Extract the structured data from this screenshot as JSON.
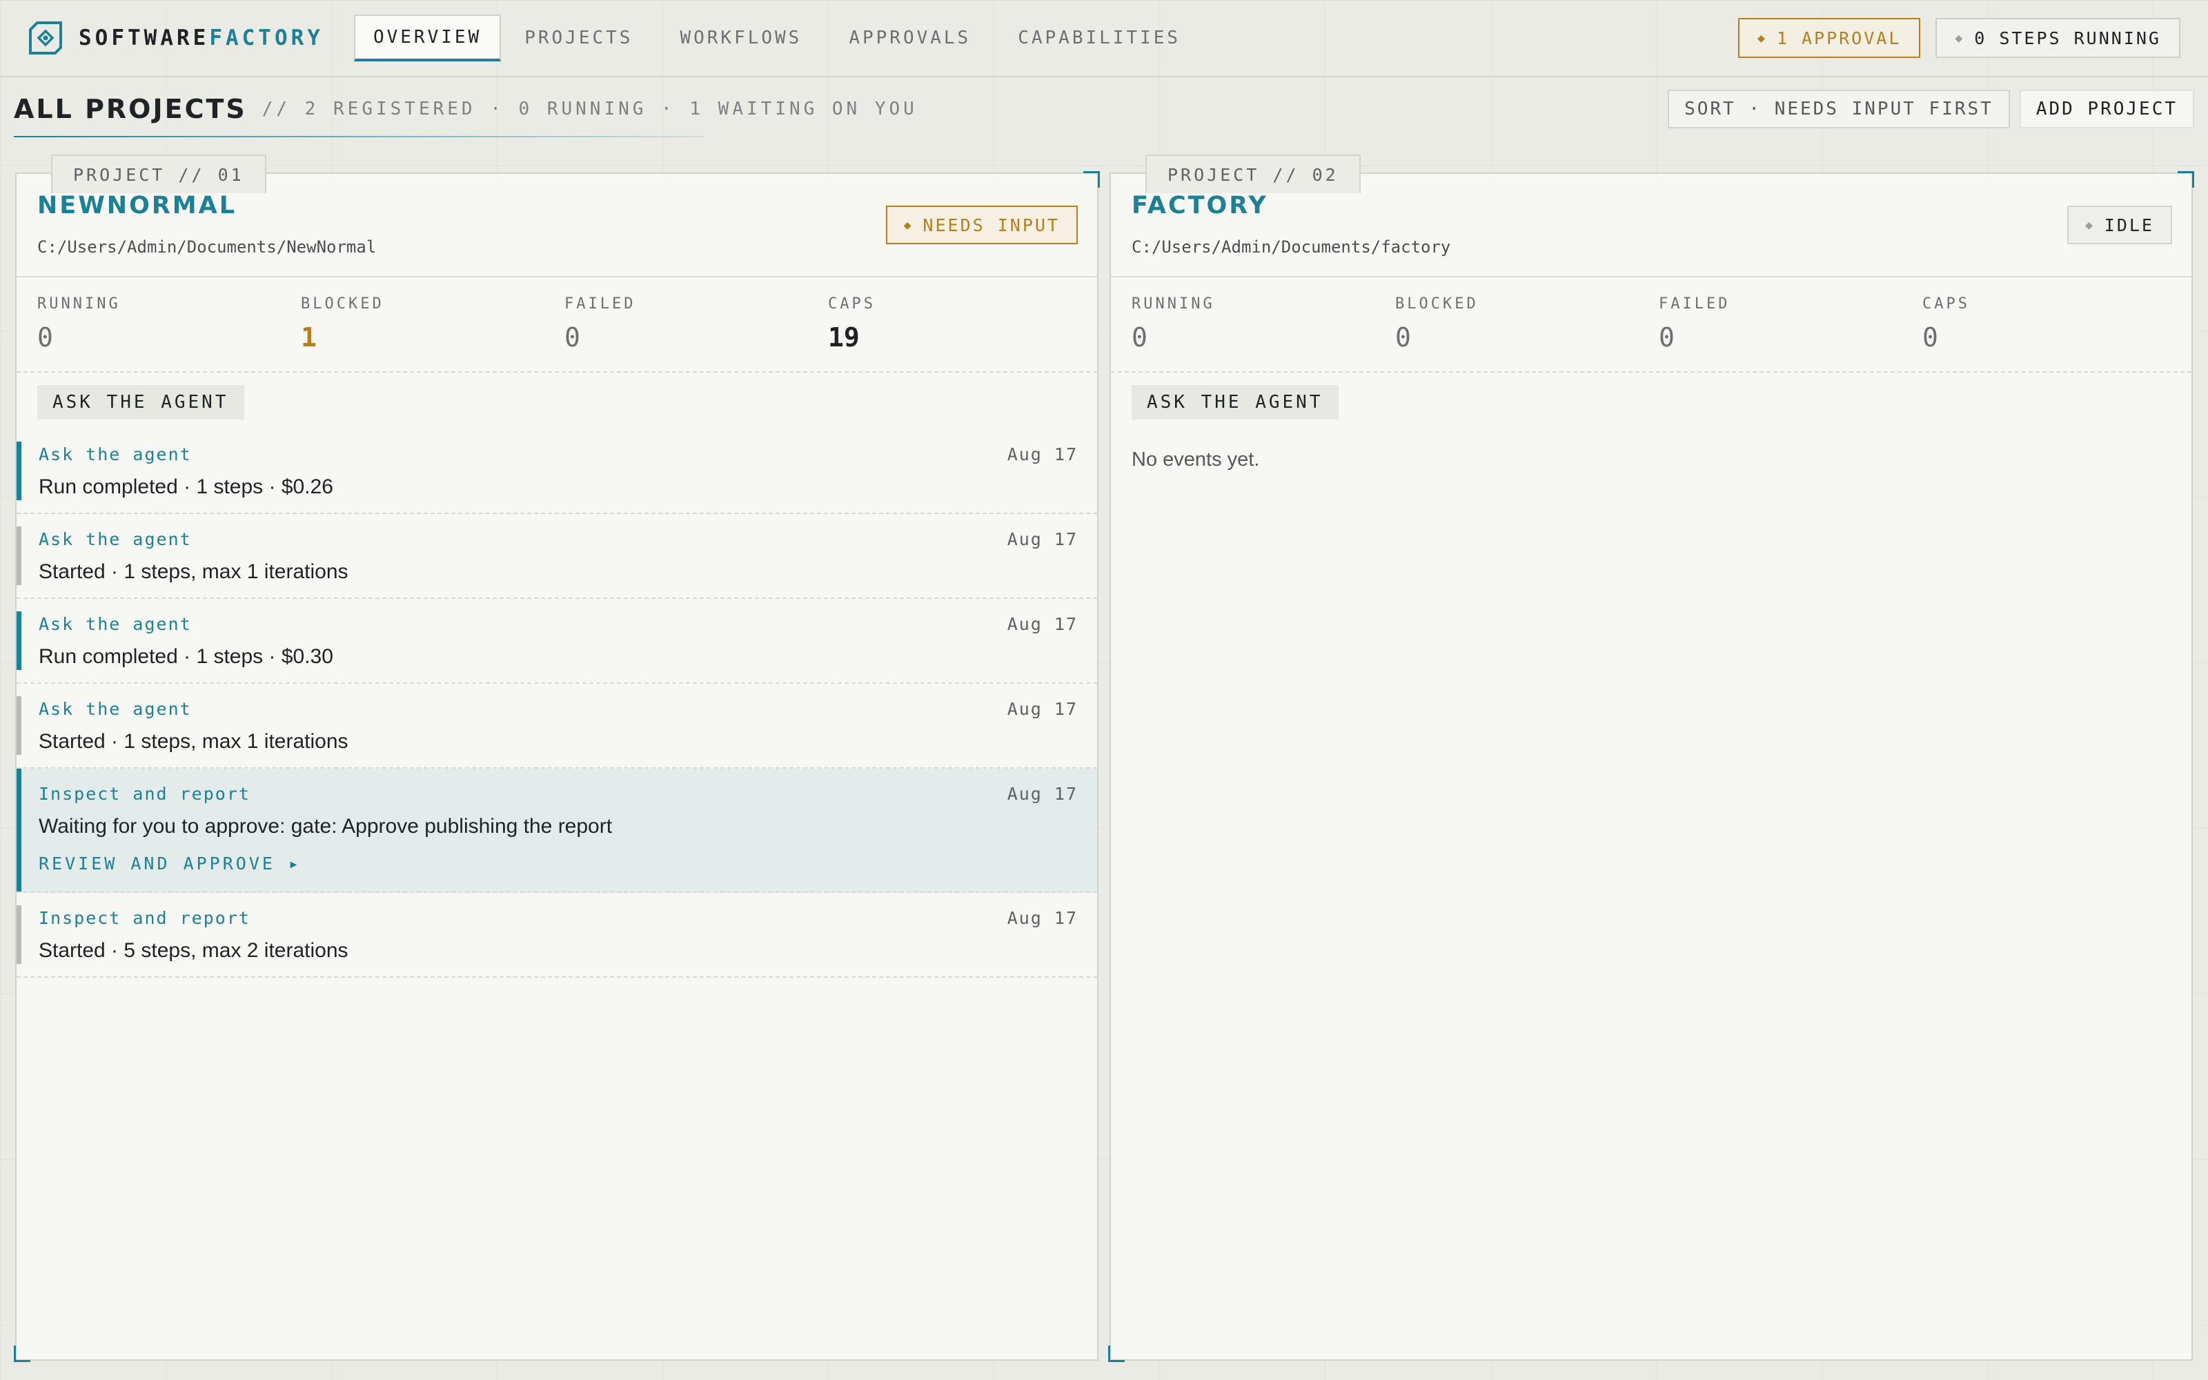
{
  "brand": {
    "part1": "SOFTWARE",
    "part2": "FACTORY"
  },
  "nav": {
    "tabs": [
      {
        "label": "OVERVIEW",
        "active": true
      },
      {
        "label": "PROJECTS"
      },
      {
        "label": "WORKFLOWS"
      },
      {
        "label": "APPROVALS"
      },
      {
        "label": "CAPABILITIES"
      }
    ]
  },
  "top_status": {
    "approvals": "1 APPROVAL",
    "steps": "0 STEPS RUNNING"
  },
  "header": {
    "title": "ALL PROJECTS",
    "summary": "// 2 REGISTERED · 0 RUNNING · 1 WAITING ON YOU",
    "sort_label": "SORT · NEEDS INPUT FIRST",
    "add_label": "ADD PROJECT"
  },
  "colors": {
    "accent": "#1c8196",
    "warning": "#b57f1d"
  },
  "stat_labels": {
    "running": "RUNNING",
    "blocked": "BLOCKED",
    "failed": "FAILED",
    "caps": "CAPS"
  },
  "projects": [
    {
      "tab": "PROJECT // 01",
      "name": "NEWNORMAL",
      "path": "C:/Users/Admin/Documents/NewNormal",
      "status": "NEEDS INPUT",
      "stats": {
        "running": "0",
        "blocked": "1",
        "failed": "0",
        "caps": "19"
      },
      "ask_label": "ASK THE AGENT",
      "events": [
        {
          "source": "Ask the agent",
          "date": "Aug 17",
          "text": "Run completed · 1 steps · $0.26"
        },
        {
          "source": "Ask the agent",
          "date": "Aug 17",
          "text": "Started · 1 steps, max 1 iterations"
        },
        {
          "source": "Ask the agent",
          "date": "Aug 17",
          "text": "Run completed · 1 steps · $0.30"
        },
        {
          "source": "Ask the agent",
          "date": "Aug 17",
          "text": "Started · 1 steps, max 1 iterations"
        },
        {
          "source": "Inspect and report",
          "date": "Aug 17",
          "text": "Waiting for you to approve: gate: Approve publishing the report",
          "action": "REVIEW AND APPROVE ▸"
        },
        {
          "source": "Inspect and report",
          "date": "Aug 17",
          "text": "Started · 5 steps, max 2 iterations"
        }
      ]
    },
    {
      "tab": "PROJECT // 02",
      "name": "FACTORY",
      "path": "C:/Users/Admin/Documents/factory",
      "status": "IDLE",
      "stats": {
        "running": "0",
        "blocked": "0",
        "failed": "0",
        "caps": "0"
      },
      "ask_label": "ASK THE AGENT",
      "empty_text": "No events yet."
    }
  ]
}
